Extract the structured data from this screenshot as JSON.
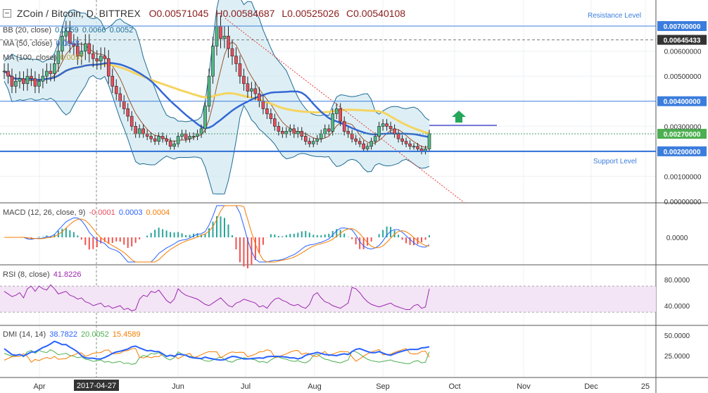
{
  "header": {
    "symbol": "ZCoin / Bitcoin, D, BITTREX",
    "open_label": "O",
    "open": "0.00571045",
    "high_label": "H",
    "high": "0.00584687",
    "low_label": "L",
    "low": "0.00525026",
    "close_label": "C",
    "close": "0.00540108"
  },
  "indicators": {
    "bb": {
      "label": "BB (20, close)",
      "v1": "0.0059",
      "v2": "0.0066",
      "v3": "0.0052"
    },
    "ma50": {
      "label": "MA (50, close)",
      "value": "0.0048"
    },
    "ma100": {
      "label": "MA (100, close)",
      "value": "0.0057"
    },
    "macd": {
      "label": "MACD (12, 26, close, 9)",
      "v1": "-0.0001",
      "v2": "0.0003",
      "v3": "0.0004"
    },
    "rsi": {
      "label": "RSI (8, close)",
      "value": "41.8226"
    },
    "dmi": {
      "label": "DMI (14, 14)",
      "v1": "38.7822",
      "v2": "20.0052",
      "v3": "15.4589"
    }
  },
  "annotations": {
    "resistance": "Resistance Level",
    "support": "Support Level"
  },
  "colors": {
    "up": "#53b987",
    "down": "#eb4d5c",
    "bb": "#1e6b94",
    "bb_fill": "#d4ebf2",
    "ma50": "#3367d6",
    "ma100": "#f5d45f",
    "ma_short": "#a0522d",
    "level": "#3b7ddd",
    "macd": "#2962ff",
    "signal": "#f57c00",
    "rsi": "#9c27b0",
    "rsi_band": "#f3e5f5",
    "dmi_plus": "#4caf50",
    "dmi_minus": "#f57c00",
    "adx": "#2962ff",
    "arrow": "#26a65b",
    "trend": "#e53935"
  },
  "chart_data": {
    "type": "line",
    "title": "ZCoin / Bitcoin, D, BITTREX",
    "x_ticks": [
      "Apr",
      "2017-04-27",
      "Jun",
      "Jul",
      "Aug",
      "Sep",
      "Oct",
      "Nov",
      "Dec",
      "25"
    ],
    "y_ticks": [
      "0.00600000",
      "0.00500000",
      "0.00300000",
      "0.00100000",
      "0.00000000"
    ],
    "ylim": [
      0,
      0.0075
    ],
    "levels": [
      {
        "name": "resistance",
        "value": 0.007,
        "label": "0.00700000"
      },
      {
        "name": "high-mark",
        "value": 0.00645,
        "label": "0.00645433"
      },
      {
        "name": "mid",
        "value": 0.004,
        "label": "0.00400000"
      },
      {
        "name": "last",
        "value": 0.0027,
        "label": "0.00270000"
      },
      {
        "name": "support",
        "value": 0.002,
        "label": "0.00200000"
      }
    ],
    "price_close": [
      0.0052,
      0.005,
      0.0046,
      0.0048,
      0.0049,
      0.0047,
      0.005,
      0.0049,
      0.0046,
      0.0048,
      0.005,
      0.0052,
      0.0051,
      0.0055,
      0.006,
      0.0066,
      0.0068,
      0.0063,
      0.0062,
      0.0058,
      0.006,
      0.0063,
      0.0059,
      0.0057,
      0.0056,
      0.0058,
      0.0057,
      0.005,
      0.0046,
      0.0043,
      0.004,
      0.0037,
      0.0034,
      0.003,
      0.0027,
      0.0029,
      0.0027,
      0.0026,
      0.0025,
      0.0024,
      0.0026,
      0.0025,
      0.0024,
      0.0022,
      0.0023,
      0.0026,
      0.0027,
      0.0025,
      0.0026,
      0.0026,
      0.0027,
      0.0029,
      0.0038,
      0.005,
      0.0062,
      0.007,
      0.0065,
      0.0066,
      0.0061,
      0.0058,
      0.0055,
      0.005,
      0.0047,
      0.0044,
      0.0045,
      0.0043,
      0.004,
      0.0037,
      0.0035,
      0.0033,
      0.003,
      0.0028,
      0.0027,
      0.0028,
      0.0029,
      0.0027,
      0.0028,
      0.0026,
      0.0024,
      0.0023,
      0.0024,
      0.0025,
      0.0027,
      0.0029,
      0.0028,
      0.0035,
      0.0037,
      0.0032,
      0.0028,
      0.0027,
      0.0025,
      0.0024,
      0.0023,
      0.0021,
      0.0022,
      0.0024,
      0.0026,
      0.003,
      0.0031,
      0.003,
      0.0029,
      0.0027,
      0.0025,
      0.0024,
      0.0023,
      0.0022,
      0.0022,
      0.0021,
      0.002,
      0.0021,
      0.0027
    ],
    "rsi": [
      62,
      58,
      54,
      56,
      60,
      52,
      66,
      70,
      62,
      70,
      66,
      64,
      72,
      66,
      58,
      60,
      62,
      56,
      54,
      50,
      52,
      46,
      44,
      40,
      42,
      44,
      38,
      40,
      36,
      38,
      40,
      34,
      36,
      32,
      34,
      50,
      56,
      54,
      62,
      60,
      64,
      56,
      48,
      44,
      50,
      66,
      60,
      56,
      54,
      52,
      50,
      46,
      42,
      40,
      44,
      48,
      52,
      46,
      40,
      38,
      44,
      46,
      50,
      48,
      46,
      44,
      38,
      40,
      36,
      44,
      50,
      52,
      48,
      46,
      42,
      40,
      42,
      38,
      36,
      42,
      56,
      60,
      52,
      46,
      44,
      40,
      38,
      36,
      40,
      44,
      68,
      66,
      60,
      52,
      46,
      42,
      40,
      38,
      40,
      42,
      44,
      40,
      38,
      36,
      34,
      34,
      40,
      42,
      36,
      38,
      66
    ]
  }
}
